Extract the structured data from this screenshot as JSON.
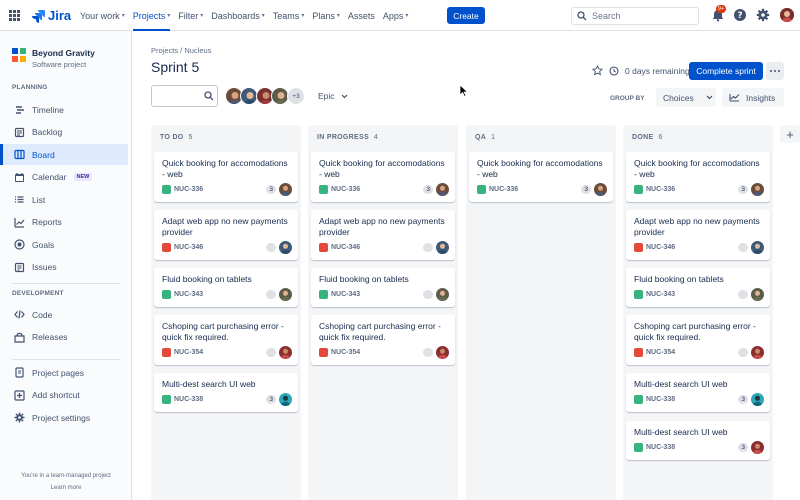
{
  "app": {
    "logo_text": "Jira",
    "brand_color": "#0052CC"
  },
  "topnav": {
    "items": [
      {
        "label": "Your work",
        "chevron": true,
        "active": false
      },
      {
        "label": "Projects",
        "chevron": true,
        "active": true
      },
      {
        "label": "Filter",
        "chevron": true,
        "active": false
      },
      {
        "label": "Dashboards",
        "chevron": true,
        "active": false
      },
      {
        "label": "Teams",
        "chevron": true,
        "active": false
      },
      {
        "label": "Plans",
        "chevron": true,
        "active": false
      },
      {
        "label": "Assets",
        "chevron": false,
        "active": false
      },
      {
        "label": "Apps",
        "chevron": true,
        "active": false
      }
    ],
    "create_label": "Create",
    "search_placeholder": "Search",
    "notification_count": "9+"
  },
  "sidebar": {
    "project_name": "Beyond Gravity",
    "project_type": "Software project",
    "planning_title": "PLANNING",
    "planning_items": [
      {
        "label": "Timeline",
        "icon": "timeline-icon"
      },
      {
        "label": "Backlog",
        "icon": "backlog-icon"
      },
      {
        "label": "Board",
        "icon": "board-icon",
        "active": true
      },
      {
        "label": "Calendar",
        "icon": "calendar-icon",
        "badge": "NEW"
      },
      {
        "label": "List",
        "icon": "list-icon"
      },
      {
        "label": "Reports",
        "icon": "reports-icon"
      },
      {
        "label": "Goals",
        "icon": "goals-icon"
      },
      {
        "label": "Issues",
        "icon": "issues-icon"
      }
    ],
    "development_title": "DEVELOPMENT",
    "development_items": [
      {
        "label": "Code",
        "icon": "code-icon"
      },
      {
        "label": "Releases",
        "icon": "releases-icon"
      }
    ],
    "other_items": [
      {
        "label": "Project pages",
        "icon": "pages-icon"
      },
      {
        "label": "Add shortcut",
        "icon": "add-shortcut-icon"
      },
      {
        "label": "Project settings",
        "icon": "settings-icon"
      }
    ],
    "footer_text": "You're in a team-managed project",
    "footer_link": "Learn more"
  },
  "header": {
    "breadcrumb": "Projects / Nucleus",
    "title": "Sprint 5",
    "days_remaining": "0 days remaining",
    "complete_label": "Complete sprint",
    "extra_avatars": "+3",
    "epic_label": "Epic",
    "groupby_label": "GROUP BY",
    "groupby_value": "Choices",
    "insights_label": "Insights"
  },
  "columns": [
    {
      "name": "TO DO",
      "count": "5",
      "cards": [
        {
          "title": "Quick booking for accomodations - web",
          "type": "story",
          "key": "NUC-336",
          "points": "3",
          "avatar": "brown"
        },
        {
          "title": "Adapt web app no new payments provider",
          "type": "bug",
          "key": "NUC-346",
          "points": "",
          "avatar": "blue"
        },
        {
          "title": "Fluid booking on tablets",
          "type": "story",
          "key": "NUC-343",
          "points": "",
          "avatar": "olive"
        },
        {
          "title": "Cshoping cart purchasing error - quick fix required.",
          "type": "bug",
          "key": "NUC-354",
          "points": "",
          "avatar": "red"
        },
        {
          "title": "Multi-dest search UI web",
          "type": "story",
          "key": "NUC-338",
          "points": "3",
          "avatar": "teal"
        }
      ]
    },
    {
      "name": "IN PROGRESS",
      "count": "4",
      "cards": [
        {
          "title": "Quick booking for accomodations - web",
          "type": "story",
          "key": "NUC-336",
          "points": "3",
          "avatar": "brown"
        },
        {
          "title": "Adapt web app no new payments provider",
          "type": "bug",
          "key": "NUC-346",
          "points": "",
          "avatar": "blue"
        },
        {
          "title": "Fluid booking on tablets",
          "type": "story",
          "key": "NUC-343",
          "points": "",
          "avatar": "olive"
        },
        {
          "title": "Cshoping cart purchasing error - quick fix required.",
          "type": "bug",
          "key": "NUC-354",
          "points": "",
          "avatar": "red"
        }
      ]
    },
    {
      "name": "QA",
      "count": "1",
      "cards": [
        {
          "title": "Quick booking for accomodations - web",
          "type": "story",
          "key": "NUC-336",
          "points": "3",
          "avatar": "brown"
        }
      ]
    },
    {
      "name": "DONE",
      "count": "6",
      "cards": [
        {
          "title": "Quick booking for accomodations - web",
          "type": "story",
          "key": "NUC-336",
          "points": "3",
          "avatar": "brown"
        },
        {
          "title": "Adapt web app no new payments provider",
          "type": "bug",
          "key": "NUC-346",
          "points": "",
          "avatar": "blue"
        },
        {
          "title": "Fluid booking on tablets",
          "type": "story",
          "key": "NUC-343",
          "points": "",
          "avatar": "olive"
        },
        {
          "title": "Cshoping cart purchasing error - quick fix required.",
          "type": "bug",
          "key": "NUC-354",
          "points": "",
          "avatar": "red"
        },
        {
          "title": "Multi-dest search UI web",
          "type": "story",
          "key": "NUC-338",
          "points": "3",
          "avatar": "teal"
        },
        {
          "title": "Multi-dest search UI web",
          "type": "story",
          "key": "NUC-338",
          "points": "3",
          "avatar": "red"
        }
      ]
    }
  ]
}
